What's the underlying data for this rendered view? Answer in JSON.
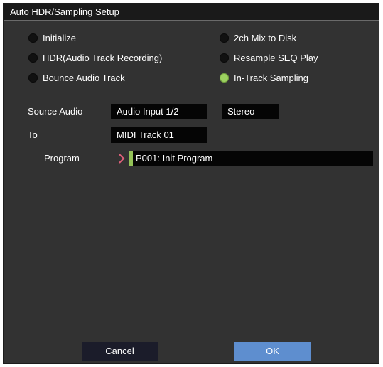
{
  "dialog": {
    "title": "Auto HDR/Sampling Setup"
  },
  "modes": [
    {
      "label": "Initialize",
      "selected": false
    },
    {
      "label": "HDR(Audio Track Recording)",
      "selected": false
    },
    {
      "label": "Bounce Audio Track",
      "selected": false
    },
    {
      "label": "2ch Mix to Disk",
      "selected": false
    },
    {
      "label": "Resample SEQ Play",
      "selected": false
    },
    {
      "label": "In-Track Sampling",
      "selected": true
    }
  ],
  "form": {
    "source_audio_label": "Source Audio",
    "source_audio_value": "Audio Input 1/2",
    "channel_value": "Stereo",
    "to_label": "To",
    "to_value": "MIDI Track 01",
    "program_label": "Program",
    "program_value": "P001: Init Program"
  },
  "buttons": {
    "cancel": "Cancel",
    "ok": "OK"
  },
  "colors": {
    "dialog_bg": "#323232",
    "selected_radio": "#9cd160",
    "ok_button": "#5e8ecf",
    "cancel_button": "#1b1c2a",
    "program_accent": "#93c257",
    "chevron": "#e0607a"
  }
}
